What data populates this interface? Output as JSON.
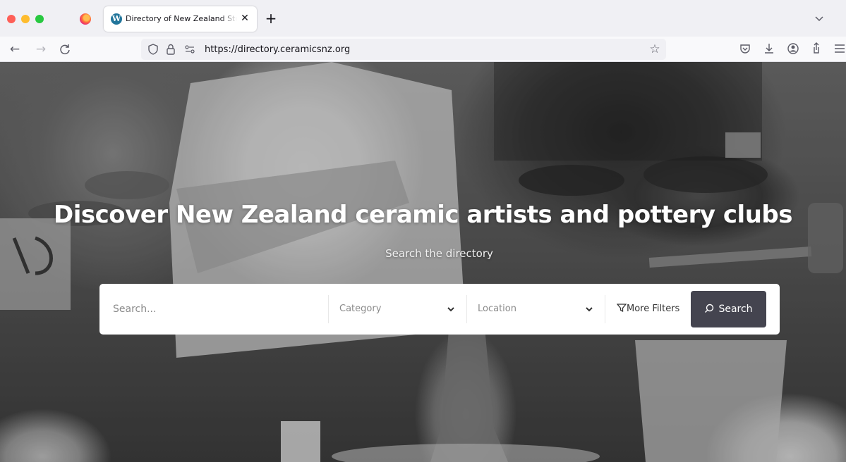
{
  "browser": {
    "tab_title": "Directory of New Zealand Studio Potters",
    "tab_close": "✕",
    "new_tab": "+",
    "url": "https://directory.ceramicsnz.org"
  },
  "hero": {
    "title": "Discover New Zealand ceramic artists and pottery clubs",
    "subtitle": "Search the directory"
  },
  "search": {
    "placeholder": "Search...",
    "category_label": "Category",
    "location_label": "Location",
    "more_filters_label": "More Filters",
    "button_label": "Search"
  },
  "colors": {
    "button_bg": "#44444f",
    "wordpress_blue": "#21759b"
  }
}
